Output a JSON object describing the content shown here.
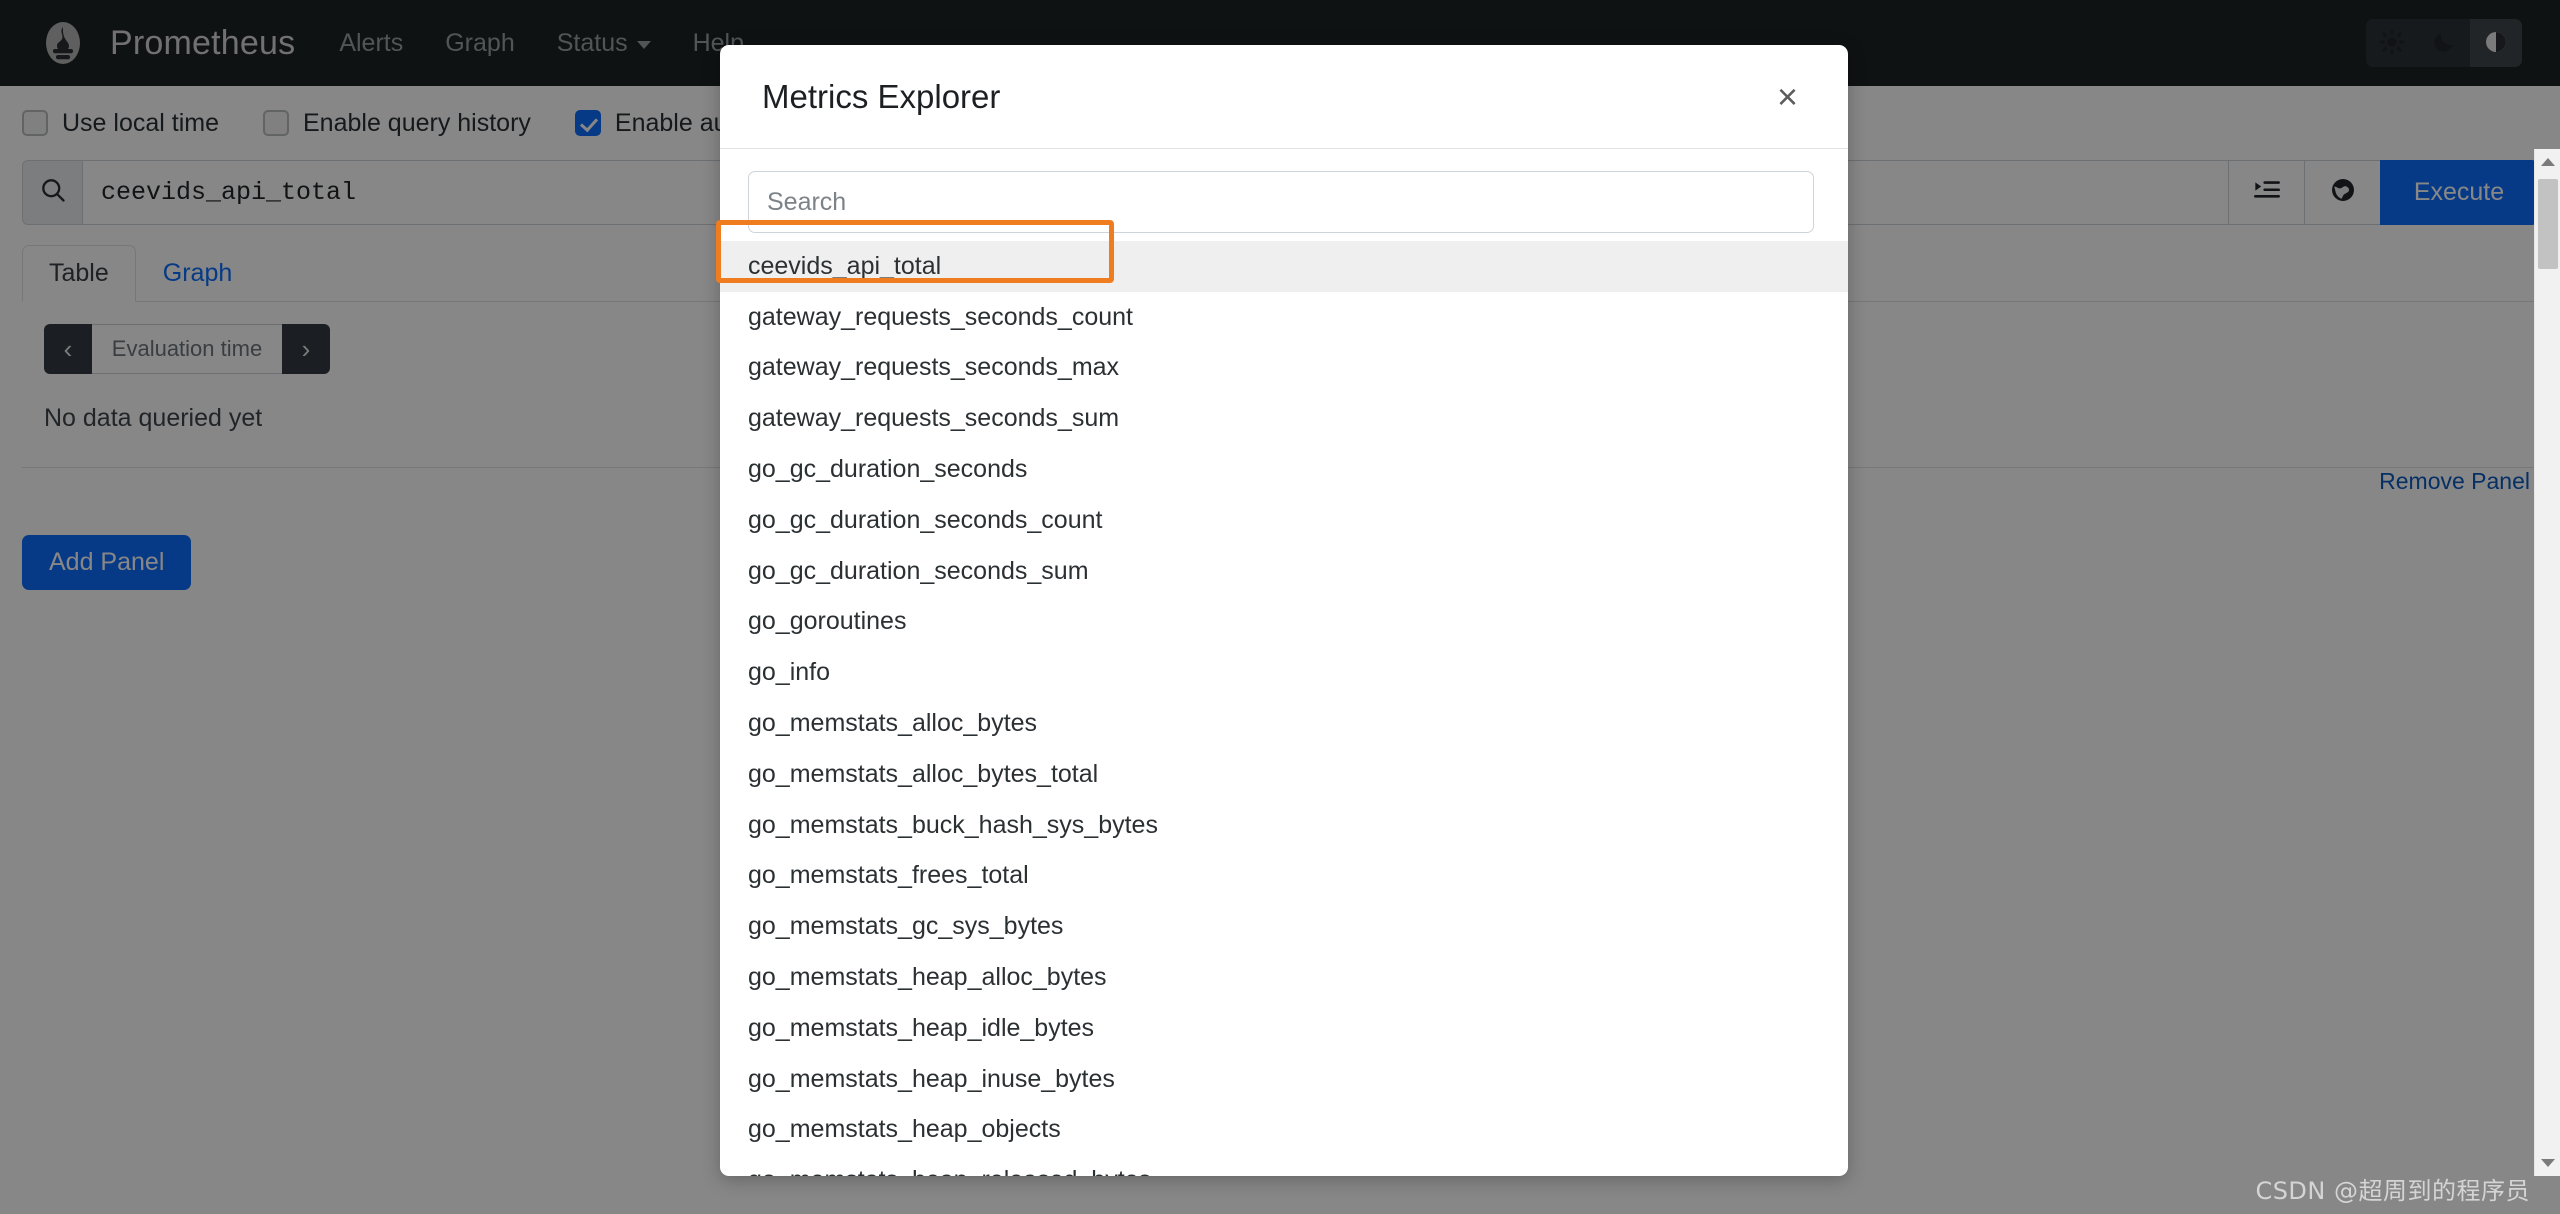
{
  "navbar": {
    "logo_icon": "prometheus-torch-logo",
    "brand": "Prometheus",
    "links": [
      {
        "label": "Alerts",
        "has_caret": false
      },
      {
        "label": "Graph",
        "has_caret": false
      },
      {
        "label": "Status",
        "has_caret": true
      },
      {
        "label": "Help",
        "has_caret": false
      }
    ],
    "theme_buttons": [
      {
        "icon": "sun-icon",
        "name": "light-theme",
        "active": false
      },
      {
        "icon": "moon-icon",
        "name": "dark-theme",
        "active": false
      },
      {
        "icon": "contrast-half-circle-icon",
        "name": "auto-theme",
        "active": true
      }
    ]
  },
  "options": [
    {
      "label": "Use local time",
      "checked": false
    },
    {
      "label": "Enable query history",
      "checked": false
    },
    {
      "label": "Enable autocomplete",
      "checked": true
    }
  ],
  "query": {
    "search_icon": "search-icon",
    "value": "ceevids_api_total",
    "metrics_explorer_icon": "metrics-explorer-icon",
    "globe_icon": "globe-icon",
    "execute_label": "Execute"
  },
  "panel": {
    "tabs": [
      {
        "label": "Table",
        "active": true
      },
      {
        "label": "Graph",
        "active": false
      }
    ],
    "eval_prev_icon": "chevron-left-icon",
    "eval_placeholder": "Evaluation time",
    "eval_next_icon": "chevron-right-icon",
    "no_data_text": "No data queried yet",
    "remove_panel_label": "Remove Panel",
    "add_panel_label": "Add Panel"
  },
  "modal": {
    "title": "Metrics Explorer",
    "close_icon": "close-icon",
    "search_placeholder": "Search",
    "search_value": "",
    "metrics": [
      "ceevids_api_total",
      "gateway_requests_seconds_count",
      "gateway_requests_seconds_max",
      "gateway_requests_seconds_sum",
      "go_gc_duration_seconds",
      "go_gc_duration_seconds_count",
      "go_gc_duration_seconds_sum",
      "go_goroutines",
      "go_info",
      "go_memstats_alloc_bytes",
      "go_memstats_alloc_bytes_total",
      "go_memstats_buck_hash_sys_bytes",
      "go_memstats_frees_total",
      "go_memstats_gc_sys_bytes",
      "go_memstats_heap_alloc_bytes",
      "go_memstats_heap_idle_bytes",
      "go_memstats_heap_inuse_bytes",
      "go_memstats_heap_objects",
      "go_memstats_heap_released_bytes"
    ],
    "hovered_index": 0,
    "scrollbar": {
      "up_icon": "scroll-up-arrow-icon",
      "down_icon": "scroll-down-arrow-icon"
    }
  },
  "annotation": {
    "color": "#f07c20",
    "target": "ceevids_api_total"
  },
  "watermark": "CSDN @超周到的程序员",
  "colors": {
    "navbar_bg": "#1e2225",
    "accent": "#0d6efd",
    "annotation": "#f07c20",
    "hover_row": "#efefef"
  }
}
